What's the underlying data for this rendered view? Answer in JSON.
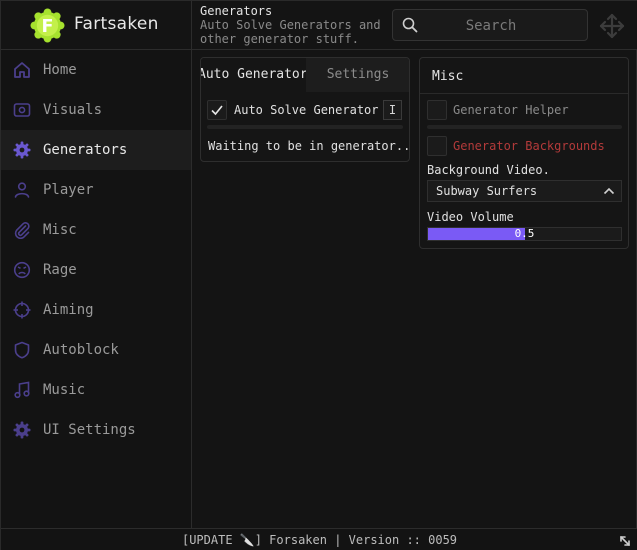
{
  "app": {
    "name": "Fartsaken",
    "logo_letter": "F"
  },
  "header": {
    "title": "Generators",
    "subtitle": "Auto Solve Generators and other generator stuff.",
    "search_placeholder": "Search"
  },
  "sidebar": {
    "items": [
      {
        "label": "Home",
        "icon": "home-icon"
      },
      {
        "label": "Visuals",
        "icon": "eye-icon"
      },
      {
        "label": "Generators",
        "icon": "gear-icon",
        "active": true
      },
      {
        "label": "Player",
        "icon": "user-icon"
      },
      {
        "label": "Misc",
        "icon": "paperclip-icon"
      },
      {
        "label": "Rage",
        "icon": "angry-face-icon"
      },
      {
        "label": "Aiming",
        "icon": "crosshair-icon"
      },
      {
        "label": "Autoblock",
        "icon": "shield-icon"
      },
      {
        "label": "Music",
        "icon": "music-note-icon"
      },
      {
        "label": "UI Settings",
        "icon": "settings-icon"
      }
    ]
  },
  "left_panel": {
    "tabs": [
      "Auto Generator",
      "Settings"
    ],
    "auto_solve_label": "Auto Solve Generator",
    "auto_solve_checked": true,
    "keybind": "I",
    "status": "Waiting to be in generator..."
  },
  "right_panel": {
    "title": "Misc",
    "generator_helper": {
      "label": "Generator Helper",
      "checked": false
    },
    "generator_backgrounds": {
      "label": "Generator Backgrounds",
      "checked": false
    },
    "background_video_label": "Background Video.",
    "background_video_value": "Subway Surfers",
    "video_volume_label": "Video Volume",
    "video_volume_value": "0.5",
    "video_volume_fraction": 0.5
  },
  "footer": {
    "text": "[UPDATE 🔪] Forsaken | Version :: 0059"
  },
  "colors": {
    "accent": "#7a5af5",
    "logo_green": "#a6e22e",
    "warning_text": "#b33a3a",
    "muted_text": "#8a8a8a"
  }
}
